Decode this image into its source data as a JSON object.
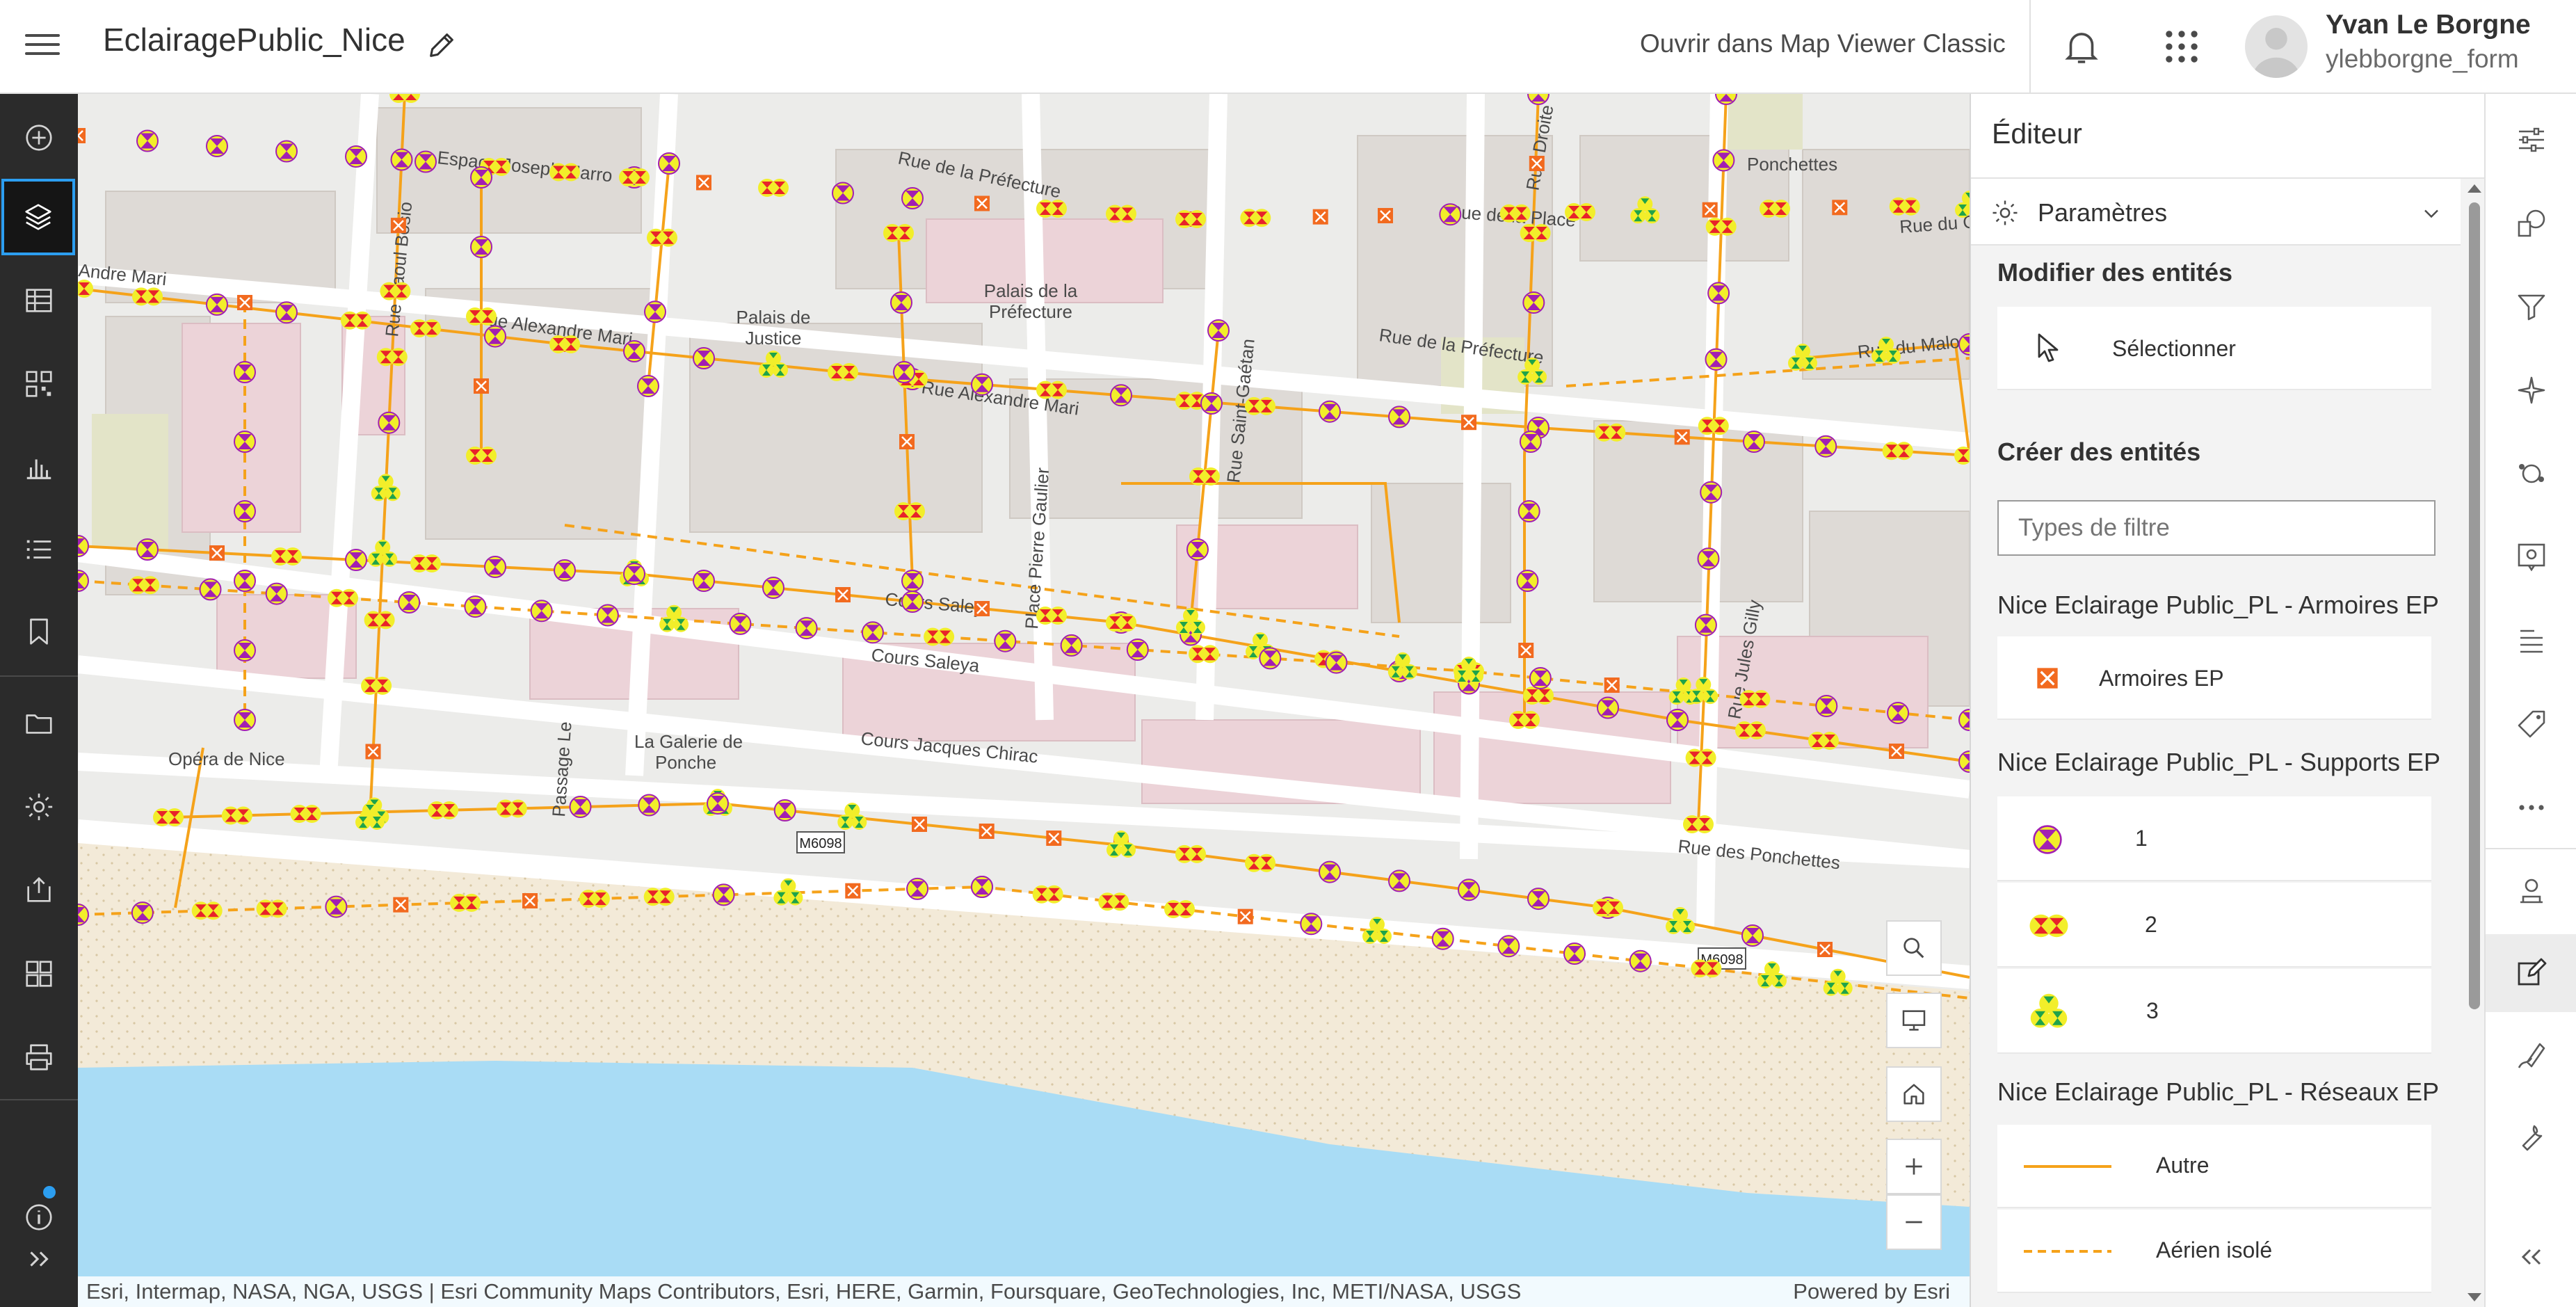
{
  "header": {
    "app_title": "EclairagePublic_Nice",
    "classic_link": "Ouvrir dans Map Viewer Classic",
    "user_name": "Yvan Le Borgne",
    "user_login": "ylebborgne_form"
  },
  "map": {
    "labels": [
      "Espace Joseph Marro",
      "Rue de la Préfecture",
      "Palais de la",
      "Préfecture",
      "Palais de",
      "Justice",
      "Rue Alexandre Mari",
      "Rue Alexandre Mari",
      "Rue Raoul Bosio",
      "Cours Saley",
      "Cours Saleya",
      "Cours Jacques Chirac",
      "Place Pierre Gaulier",
      "Opéra de Nice",
      "La Galerie de",
      "Ponche",
      "Passage Le",
      "Rue de la Préfecture",
      "Rue du Malonat",
      "Rue des Ponchettes",
      "Rue Jules Gilly",
      "Rue Saint-Gaétan",
      "Andre Mari",
      "Rue du C",
      "Rue de la Place",
      "Rue Droite",
      "Ponchettes"
    ],
    "road_badges": [
      "M6098",
      "M6098"
    ],
    "attribution": "Esri, Intermap, NASA, NGA, USGS | Esri Community Maps Contributors, Esri, HERE, Garmin, Foursquare, GeoTechnologies, Inc, METI/NASA, USGS",
    "powered_by": "Powered by Esri",
    "controls": [
      "search-icon",
      "screen-icon",
      "home-icon",
      "zoom-in-icon",
      "zoom-out-icon"
    ]
  },
  "editor": {
    "title": "Éditeur",
    "settings_label": "Paramètres",
    "modify_title": "Modifier des entités",
    "select_label": "Sélectionner",
    "create_title": "Créer des entités",
    "filter_placeholder": "Types de filtre",
    "groups": [
      {
        "title": "Nice Eclairage Public_PL - Armoires EP",
        "items": [
          "Armoires EP"
        ]
      },
      {
        "title": "Nice Eclairage Public_PL - Supports EP",
        "items": [
          "1",
          "2",
          "3"
        ]
      },
      {
        "title": "Nice Eclairage Public_PL - Réseaux EP",
        "items": [
          "Autre",
          "Aérien isolé"
        ]
      }
    ]
  },
  "colors": {
    "accent": "#2c9ef0",
    "line_orange": "#f5a21a",
    "symbol_yellow": "#f2ee2a",
    "symbol_purple": "#a21fb2",
    "symbol_red": "#e8232a",
    "symbol_green": "#1fa34a",
    "armoire_orange": "#f26a1f",
    "sea": "#a9dcf5",
    "beach": "#f3ead8"
  }
}
